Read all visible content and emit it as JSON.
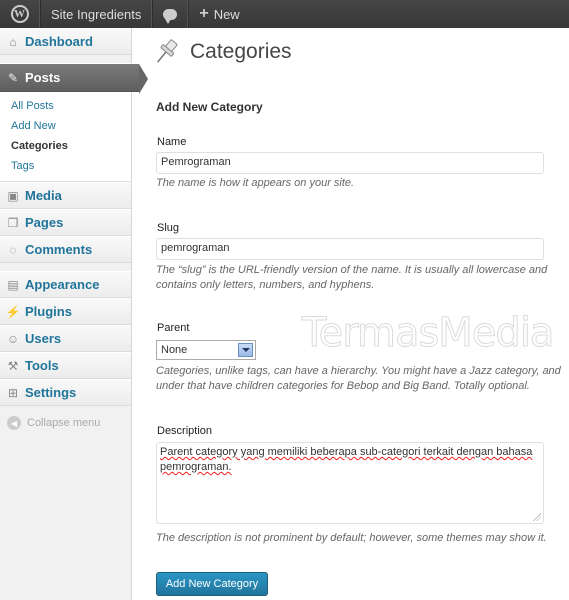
{
  "adminbar": {
    "site_name": "Site Ingredients",
    "new_label": "New"
  },
  "sidebar": {
    "items": [
      {
        "label": "Dashboard",
        "icon": "dashboard-icon"
      },
      {
        "label": "Posts",
        "icon": "pin-icon",
        "current": true
      },
      {
        "label": "Media",
        "icon": "media-icon"
      },
      {
        "label": "Pages",
        "icon": "pages-icon"
      },
      {
        "label": "Comments",
        "icon": "comments-icon"
      },
      {
        "label": "Appearance",
        "icon": "appearance-icon"
      },
      {
        "label": "Plugins",
        "icon": "plugins-icon"
      },
      {
        "label": "Users",
        "icon": "users-icon"
      },
      {
        "label": "Tools",
        "icon": "tools-icon"
      },
      {
        "label": "Settings",
        "icon": "settings-icon"
      }
    ],
    "posts_submenu": [
      "All Posts",
      "Add New",
      "Categories",
      "Tags"
    ],
    "collapse_label": "Collapse menu"
  },
  "page": {
    "title": "Categories",
    "form_title": "Add New Category",
    "name_label": "Name",
    "name_value": "Pemrograman",
    "name_desc": "The name is how it appears on your site.",
    "slug_label": "Slug",
    "slug_value": "pemrograman",
    "slug_desc": "The “slug” is the URL-friendly version of the name. It is usually all lowercase and contains only letters, numbers, and hyphens.",
    "parent_label": "Parent",
    "parent_value": "None",
    "parent_desc": "Categories, unlike tags, can have a hierarchy. You might have a Jazz category, and under that have children categories for Bebop and Big Band. Totally optional.",
    "description_label": "Description",
    "description_value": "Parent category yang memiliki beberapa sub-categori terkait dengan bahasa pemrograman.",
    "description_desc": "The description is not prominent by default; however, some themes may show it.",
    "submit_label": "Add New Category",
    "watermark": "TermasMedia"
  },
  "colors": {
    "link": "#21759b",
    "button": "#21759b",
    "adminbar": "#464646"
  }
}
